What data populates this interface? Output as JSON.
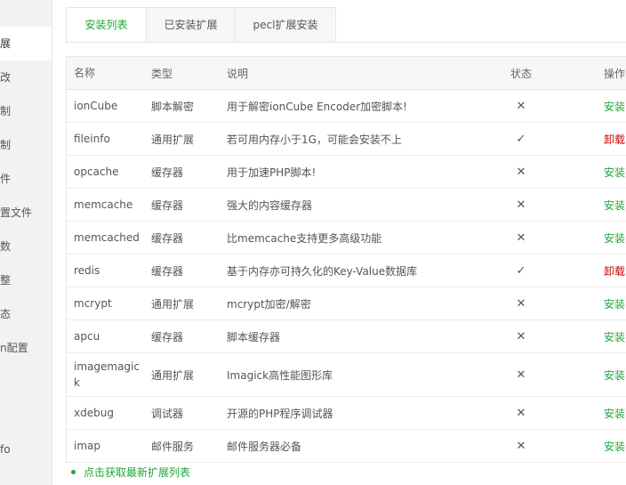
{
  "sidebar": {
    "items": [
      {
        "label": "展",
        "active": true
      },
      {
        "label": "改"
      },
      {
        "label": "制"
      },
      {
        "label": "制"
      },
      {
        "label": "件"
      },
      {
        "label": "置文件"
      },
      {
        "label": "数"
      },
      {
        "label": "整"
      },
      {
        "label": "态"
      },
      {
        "label": "n配置"
      },
      {
        "label": "fo"
      }
    ]
  },
  "tabs": [
    {
      "label": "安装列表",
      "active": true
    },
    {
      "label": "已安装扩展"
    },
    {
      "label": "pecl扩展安装"
    }
  ],
  "table": {
    "headers": {
      "name": "名称",
      "type": "类型",
      "desc": "说明",
      "status": "状态",
      "op": "操作"
    },
    "rows": [
      {
        "name": "ionCube",
        "type": "脚本解密",
        "desc": "用于解密ionCube Encoder加密脚本!",
        "installed": false,
        "op": "安装"
      },
      {
        "name": "fileinfo",
        "type": "通用扩展",
        "desc": "若可用内存小于1G，可能会安装不上",
        "installed": true,
        "op": "卸载"
      },
      {
        "name": "opcache",
        "type": "缓存器",
        "desc": "用于加速PHP脚本!",
        "installed": false,
        "op": "安装"
      },
      {
        "name": "memcache",
        "type": "缓存器",
        "desc": "强大的内容缓存器",
        "installed": false,
        "op": "安装"
      },
      {
        "name": "memcached",
        "type": "缓存器",
        "desc": "比memcache支持更多高级功能",
        "installed": false,
        "op": "安装"
      },
      {
        "name": "redis",
        "type": "缓存器",
        "desc": "基于内存亦可持久化的Key-Value数据库",
        "installed": true,
        "op": "卸载"
      },
      {
        "name": "mcrypt",
        "type": "通用扩展",
        "desc": "mcrypt加密/解密",
        "installed": false,
        "op": "安装"
      },
      {
        "name": "apcu",
        "type": "缓存器",
        "desc": "脚本缓存器",
        "installed": false,
        "op": "安装"
      },
      {
        "name": "imagemagick",
        "type": "通用扩展",
        "desc": "Imagick高性能图形库",
        "installed": false,
        "op": "安装"
      },
      {
        "name": "xdebug",
        "type": "调试器",
        "desc": "开源的PHP程序调试器",
        "installed": false,
        "op": "安装"
      },
      {
        "name": "imap",
        "type": "邮件服务",
        "desc": "邮件服务器必备",
        "installed": false,
        "op": "安装"
      }
    ]
  },
  "footer": {
    "refresh_link": "点击获取最新扩展列表"
  },
  "colors": {
    "accent": "#20a53a",
    "danger": "#cc0000"
  },
  "icons": {
    "not_installed": "cross-icon",
    "installed": "check-icon"
  }
}
